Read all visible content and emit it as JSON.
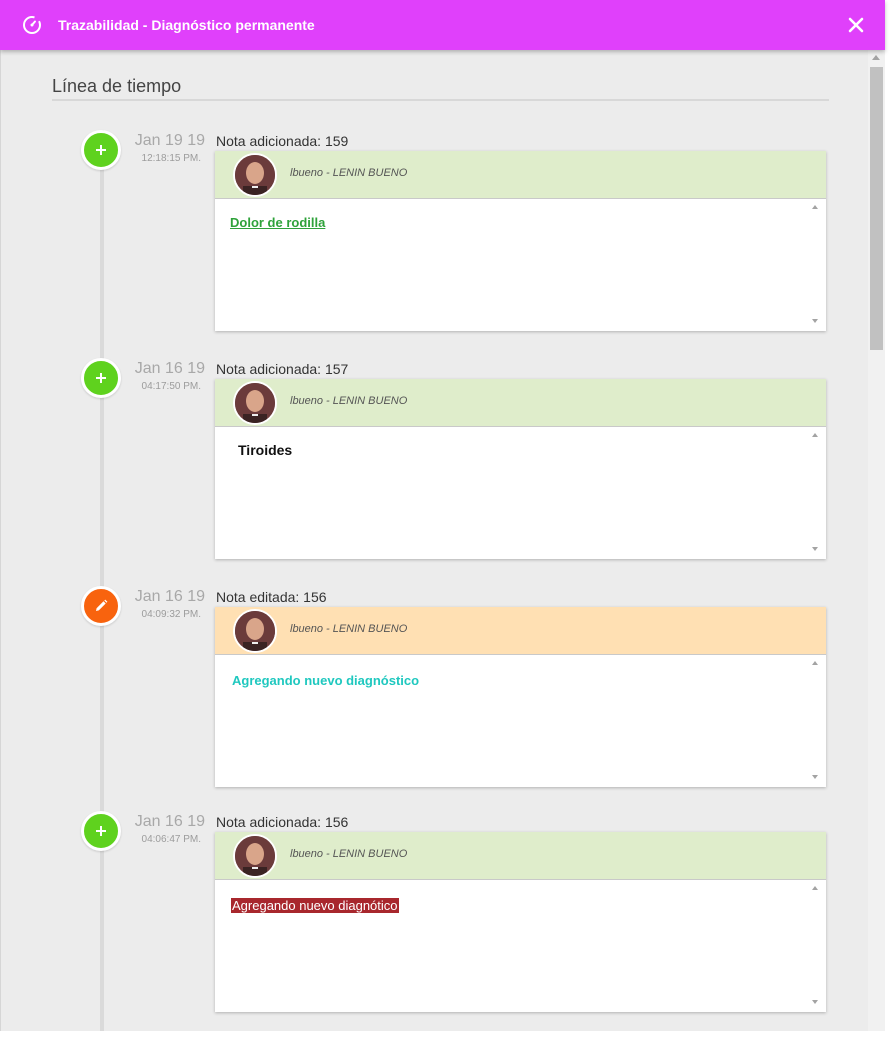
{
  "window": {
    "title": "Trazabilidad - Diagnóstico permanente",
    "title_icon": "gauge-icon",
    "close_icon": "close-icon",
    "accent_color": "#e040fb"
  },
  "timeline": {
    "heading": "Línea de tiempo",
    "entries": [
      {
        "type": "add",
        "date": "Jan 19 19",
        "time": "12:18:15 PM.",
        "title": "Nota adicionada: 159",
        "user": "lbueno",
        "fullname": "LENIN BUENO",
        "content": "Dolor de rodilla"
      },
      {
        "type": "add",
        "date": "Jan 16 19",
        "time": "04:17:50 PM.",
        "title": "Nota adicionada: 157",
        "user": "lbueno",
        "fullname": "LENIN BUENO",
        "content": "Tiroides"
      },
      {
        "type": "edit",
        "date": "Jan 16 19",
        "time": "04:09:32 PM.",
        "title": "Nota editada: 156",
        "user": "lbueno",
        "fullname": "LENIN BUENO",
        "content": "Agregando nuevo diagnóstico"
      },
      {
        "type": "add",
        "date": "Jan 16 19",
        "time": "04:06:47 PM.",
        "title": "Nota adicionada: 156",
        "user": "lbueno",
        "fullname": "LENIN BUENO",
        "content": "Agregando nuevo diagnótico"
      }
    ]
  }
}
